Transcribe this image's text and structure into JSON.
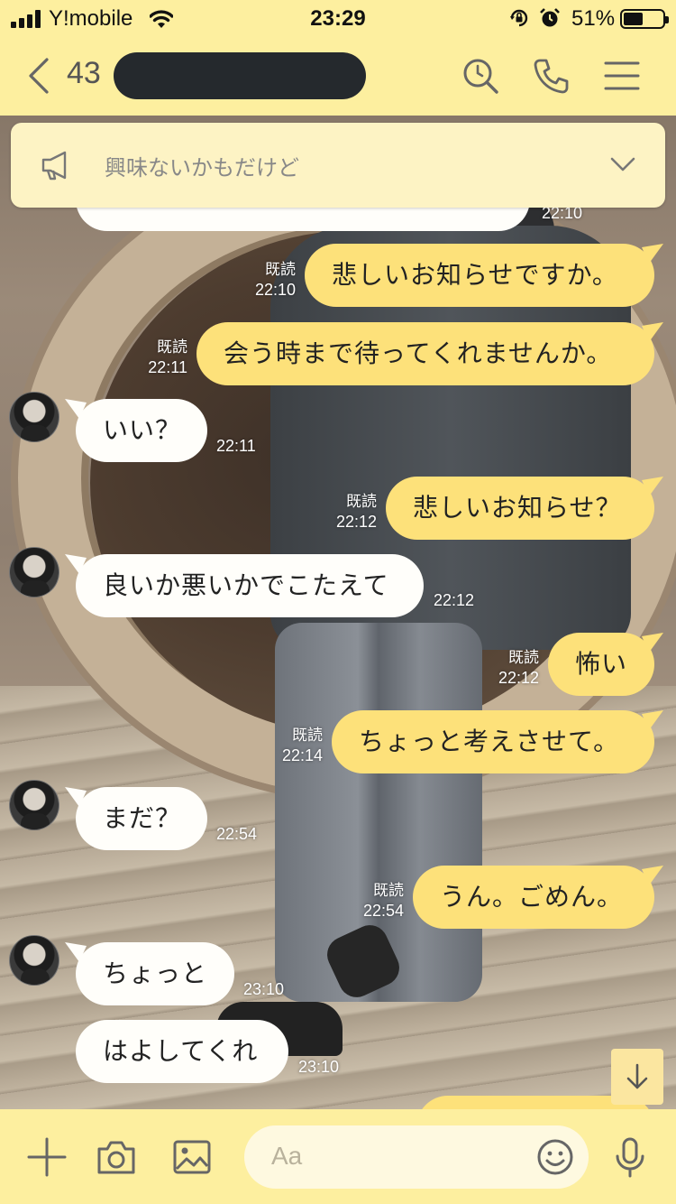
{
  "status_bar": {
    "carrier": "Y!mobile",
    "time": "23:29",
    "battery_percent": "51%",
    "battery_level": 0.51,
    "icons": [
      "signal-icon",
      "wifi-icon",
      "rotation-lock-icon",
      "alarm-icon",
      "battery-icon"
    ]
  },
  "header": {
    "unread_count": "43",
    "contact_name_redacted": true,
    "icons": [
      "back-chevron-icon",
      "search-icon",
      "phone-icon",
      "menu-icon"
    ]
  },
  "announcement": {
    "text": "興味ないかもだけど",
    "icons": [
      "megaphone-icon",
      "chevron-down-icon"
    ]
  },
  "messages": [
    {
      "dir": "in",
      "text": "",
      "time": "22:10",
      "read": ""
    },
    {
      "dir": "out",
      "text": "悲しいお知らせですか。",
      "time": "22:10",
      "read": "既読"
    },
    {
      "dir": "out",
      "text": "会う時まで待ってくれませんか。",
      "time": "22:11",
      "read": "既読"
    },
    {
      "dir": "in",
      "text": "いい？",
      "time": "22:11",
      "read": ""
    },
    {
      "dir": "out",
      "text": "悲しいお知らせ？",
      "time": "22:12",
      "read": "既読"
    },
    {
      "dir": "in",
      "text": "良いか悪いかでこたえて",
      "time": "22:12",
      "read": ""
    },
    {
      "dir": "out",
      "text": "怖い",
      "time": "22:12",
      "read": "既読"
    },
    {
      "dir": "out",
      "text": "ちょっと考えさせて。",
      "time": "22:14",
      "read": "既読"
    },
    {
      "dir": "in",
      "text": "まだ？",
      "time": "22:54",
      "read": ""
    },
    {
      "dir": "out",
      "text": "うん。ごめん。",
      "time": "22:54",
      "read": "既読"
    },
    {
      "dir": "in",
      "text": "ちょっと",
      "time": "23:10",
      "read": ""
    },
    {
      "dir": "in",
      "text": "はよしてくれ",
      "time": "23:10",
      "read": ""
    }
  ],
  "input_bar": {
    "placeholder": "Aa",
    "icons": [
      "plus-icon",
      "camera-icon",
      "image-icon",
      "emoji-icon",
      "microphone-icon"
    ]
  },
  "scroll_down": {
    "icon": "arrow-down-icon"
  },
  "colors": {
    "bar_yellow": "#fdef9f",
    "outgoing_bubble": "#fde17a",
    "incoming_bubble": "#fffefa",
    "notice_bg": "#fdf3c4"
  }
}
